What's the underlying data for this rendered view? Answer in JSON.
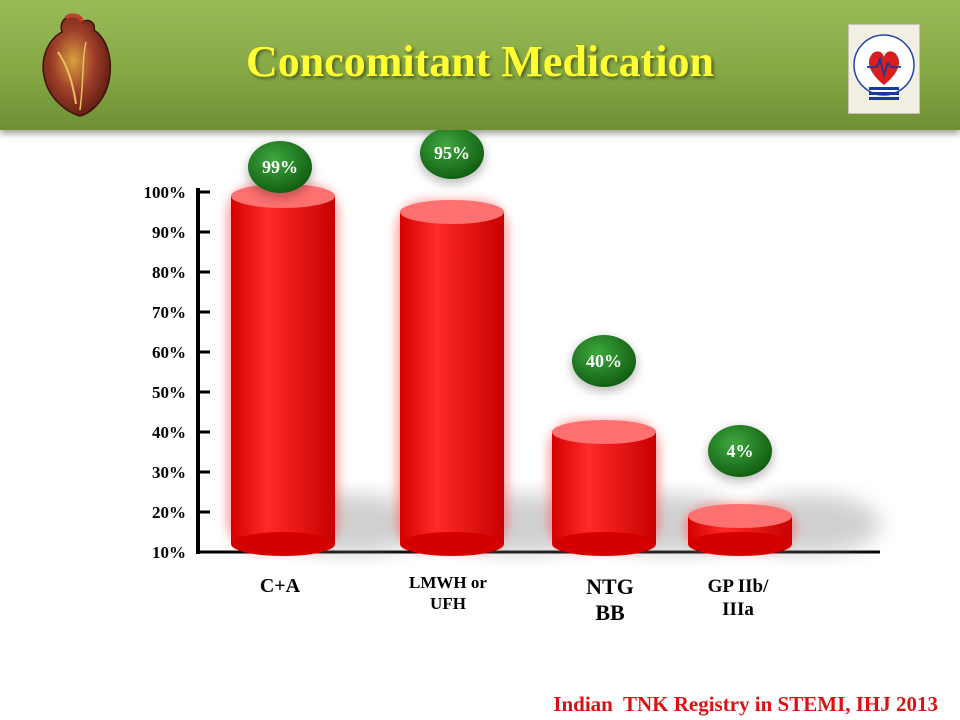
{
  "slide": {
    "title": "Concomitant Medication",
    "footer": "Indian  TNK Registry in STEMI, IHJ 2013",
    "colors": {
      "header": "#8cb04a",
      "title": "#ffff33",
      "bar": "#ff1a1a",
      "badge": "#1f7a1f",
      "footer": "#dd1111"
    },
    "icons": [
      "heart-icon",
      "cardiological-society-logo"
    ],
    "logo_text": "CARDIOLOGICAL SOCIETY OF INDIA"
  },
  "chart_data": {
    "type": "bar",
    "categories": [
      "C+A",
      "LMWH or UFH",
      "NTG BB",
      "GP IIb/ IIIa"
    ],
    "category_lines": [
      [
        "C+A"
      ],
      [
        "LMWH or",
        "UFH"
      ],
      [
        "NTG",
        "BB"
      ],
      [
        "GP IIb/",
        "IIIa"
      ]
    ],
    "values": [
      99,
      95,
      40,
      4
    ],
    "value_labels": [
      "99%",
      "95%",
      "40%",
      "4%"
    ],
    "yticks": [
      "10%",
      "20%",
      "30%",
      "40%",
      "50%",
      "60%",
      "70%",
      "80%",
      "90%",
      "100%"
    ],
    "ylim": [
      10,
      100
    ],
    "grid": false,
    "legend": "none"
  }
}
